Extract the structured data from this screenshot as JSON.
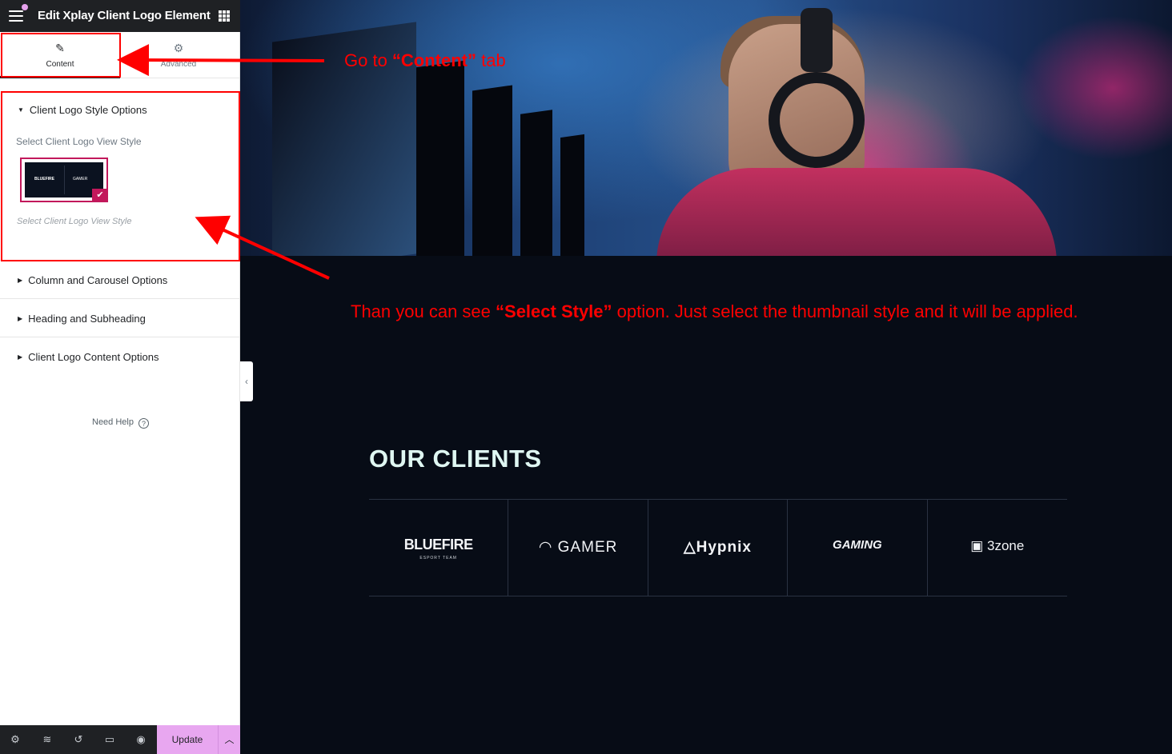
{
  "editor": {
    "title": "Edit Xplay Client Logo Element",
    "tabs": [
      {
        "label": "Content",
        "icon": "pencil-icon",
        "active": true
      },
      {
        "label": "Advanced",
        "icon": "gear-icon",
        "active": false
      }
    ],
    "sections": [
      {
        "label": "Client Logo Style Options",
        "open": true
      },
      {
        "label": "Column and Carousel Options",
        "open": false
      },
      {
        "label": "Heading and Subheading",
        "open": false
      },
      {
        "label": "Client Logo Content Options",
        "open": false
      }
    ],
    "style_control": {
      "label": "Select Client Logo View Style",
      "help": "Select Client Logo View Style",
      "selected_thumb_text": [
        "BLUEFIRE",
        "GAMER"
      ]
    },
    "need_help": "Need Help",
    "update_label": "Update"
  },
  "annotations": {
    "tab_note": {
      "pre": "Go  to ",
      "strong": "“Content”",
      "post": " tab"
    },
    "style_note": {
      "pre": "Than you can see ",
      "strong": "“Select Style”",
      "post": " option. Just select the thumbnail style and it will be applied."
    }
  },
  "preview": {
    "clients_heading": "OUR CLIENTS",
    "logos": [
      {
        "name": "BLUEFIRE",
        "tagline": "ESPORT TEAM"
      },
      {
        "name": "GAMER",
        "tagline": ""
      },
      {
        "name": "Hypnix",
        "tagline": ""
      },
      {
        "name": "GAMING",
        "tagline": ""
      },
      {
        "name": "3zone",
        "tagline": ""
      }
    ]
  },
  "colors": {
    "annotation": "#ff0000",
    "accent_pink": "#c2185b",
    "update_button": "#e8a7f0",
    "preview_bg": "#070c16"
  }
}
